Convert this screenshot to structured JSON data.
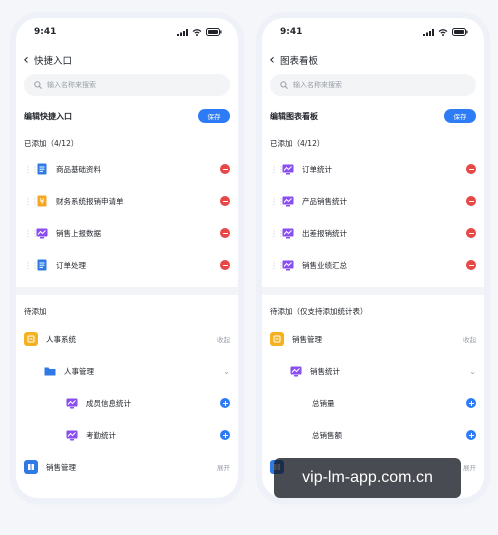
{
  "colors": {
    "accent": "#2e7bf6",
    "remove": "#e84747",
    "doc_blue": "#2f7ae5",
    "finance_orange": "#f5a623",
    "chart_purple": "#8a4ef0",
    "group_yellow": "#f5b11f",
    "group_blue": "#2f7ae5"
  },
  "left": {
    "status_time": "9:41",
    "title": "快捷入口",
    "search_placeholder": "输入名称来搜索",
    "edit_title": "编辑快捷入口",
    "save_label": "保存",
    "added_title": "已添加（4/12）",
    "added_items": [
      {
        "label": "商品基础资料",
        "icon": "document-icon"
      },
      {
        "label": "财务系统报销申请单",
        "icon": "finance-icon"
      },
      {
        "label": "销售上报数据",
        "icon": "chart-icon"
      },
      {
        "label": "订单处理",
        "icon": "document-icon"
      }
    ],
    "pending_title": "待添加",
    "group1_label": "人事系统",
    "group1_action": "收起",
    "sub_label": "人事管理",
    "leaf1": "成员信息统计",
    "leaf2": "考勤统计",
    "group2_label": "销售管理",
    "group2_action": "展开"
  },
  "right": {
    "status_time": "9:41",
    "title": "图表看板",
    "search_placeholder": "输入名称来搜索",
    "edit_title": "编辑图表看板",
    "save_label": "保存",
    "added_title": "已添加（4/12）",
    "added_items": [
      {
        "label": "订单统计",
        "icon": "chart-icon"
      },
      {
        "label": "产品销售统计",
        "icon": "chart-icon"
      },
      {
        "label": "出差报销统计",
        "icon": "chart-icon"
      },
      {
        "label": "销售业绩汇总",
        "icon": "chart-icon"
      }
    ],
    "pending_title": "待添加（仅支持添加统计表）",
    "group1_label": "销售管理",
    "group1_action": "收起",
    "sub_label": "销售统计",
    "leaf1": "总销量",
    "leaf2": "总销售额",
    "group2_action": "展开"
  },
  "watermark": "vip-lm-app.com.cn"
}
